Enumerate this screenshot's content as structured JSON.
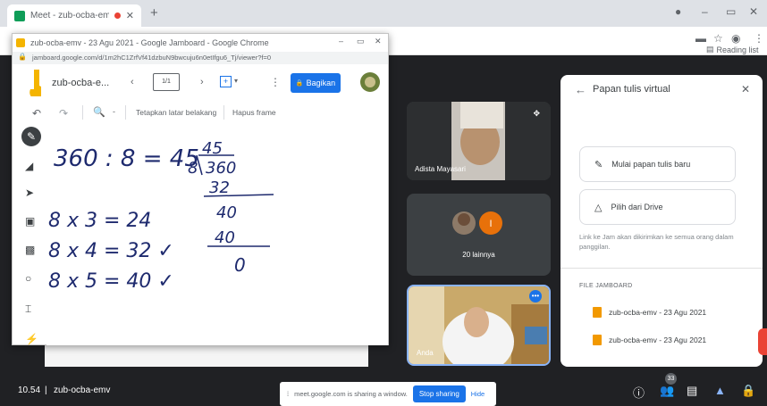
{
  "outer_browser": {
    "tab_title": "Meet - zub-ocba-emv",
    "reading_list": "Reading list"
  },
  "jamboard_window": {
    "title": "zub-ocba-emv - 23 Agu 2021 - Google Jamboard - Google Chrome",
    "url": "jamboard.google.com/d/1m2hC1ZrfVf41dzbuN9bwcuju6n0etIfgu6_Tj/viewer?f=0",
    "doc_name": "zub-ocba-e...",
    "frame_indicator": "1/1",
    "share_button": "Bagikan",
    "toolbar": {
      "zoom_label": "-",
      "set_background": "Tetapkan latar belakang",
      "clear_frame": "Hapus frame"
    }
  },
  "canvas_handwriting": [
    "360 : 8 = 45",
    "8 x 3 = 24",
    "8 x 4 = 32 ✓",
    "8 x 5 = 40 ✓"
  ],
  "long_division": {
    "quotient": "45",
    "divisor": "8",
    "dividend": "360",
    "step1": "32",
    "step2": "40",
    "step3": "40",
    "remainder": "0"
  },
  "participants": {
    "tile1_name": "Adista Mayasari",
    "tile2_avatar": "I",
    "tile2_label": "20 lainnya",
    "tile3_name": "Anda"
  },
  "side_panel": {
    "title": "Papan tulis virtual",
    "new_board": "Mulai papan tulis baru",
    "from_drive": "Pilih dari Drive",
    "info_text": "Link ke Jam akan dikirimkan ke semua orang dalam panggilan.",
    "files_heading": "FILE JAMBOARD",
    "files": [
      "zub-ocba-emv - 23 Agu 2021",
      "zub-ocba-emv - 23 Agu 2021"
    ]
  },
  "bottom_bar": {
    "time": "10.54",
    "meeting_code": "zub-ocba-emv",
    "participant_count": "33",
    "share_notice": "meet.google.com is sharing a window.",
    "stop_sharing": "Stop sharing",
    "hide": "Hide"
  },
  "colors": {
    "accent": "#1a73e8",
    "meet_bg": "#202124",
    "mic_red": "#ea4335",
    "avatar_orange": "#e8710a",
    "jam_logo": "#f4b400"
  }
}
